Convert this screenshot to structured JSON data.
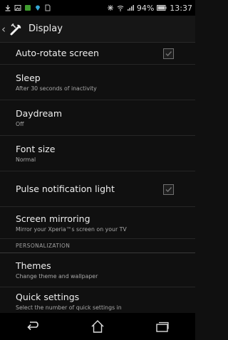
{
  "status_bar": {
    "notification_icons": [
      "download-icon",
      "image-icon",
      "app-icon",
      "location-icon",
      "sim-icon"
    ],
    "right_icons": [
      "nfc-icon",
      "wifi-icon",
      "signal-icon"
    ],
    "battery": "94%",
    "time": "13:37"
  },
  "action_bar": {
    "back_glyph": "‹",
    "icon": "wrench-icon",
    "title": "Display"
  },
  "settings": {
    "auto_rotate": {
      "title": "Auto-rotate screen",
      "checked": true
    },
    "sleep": {
      "title": "Sleep",
      "summary": "After 30 seconds of inactivity"
    },
    "daydream": {
      "title": "Daydream",
      "summary": "Off"
    },
    "font_size": {
      "title": "Font size",
      "summary": "Normal"
    },
    "pulse_light": {
      "title": "Pulse notification light",
      "checked": true
    },
    "screen_mirroring": {
      "title": "Screen mirroring",
      "summary": "Mirror your Xperia™s screen on your TV"
    },
    "personalization_header": "PERSONALIZATION",
    "themes": {
      "title": "Themes",
      "summary": "Change theme and wallpaper"
    },
    "quick_settings": {
      "title": "Quick settings",
      "summary": "Select the number of quick settings in"
    }
  },
  "nav_bar": {
    "buttons": [
      "back-icon",
      "home-icon",
      "recent-apps-icon"
    ]
  }
}
